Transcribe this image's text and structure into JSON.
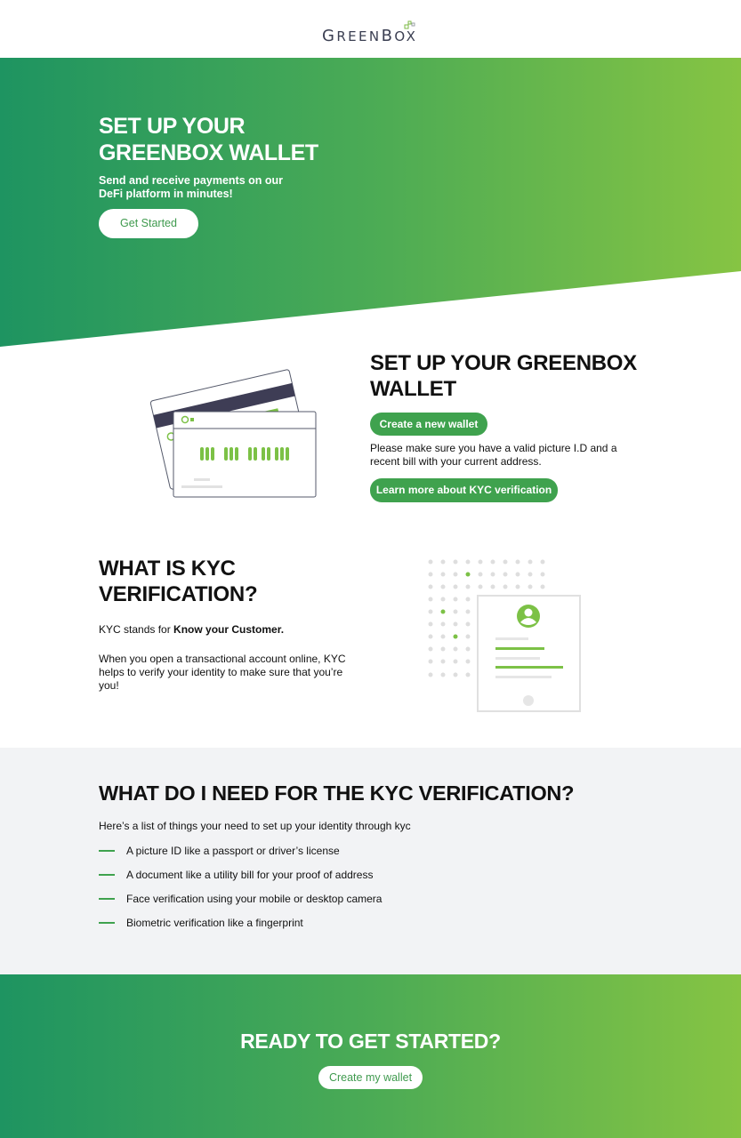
{
  "brand": {
    "logo_g": "G",
    "logo_reen": "REEN",
    "logo_b": "B",
    "logo_o": "O",
    "logo_x": "X",
    "accent": "#3fa24e",
    "gradient_start": "#1e9461",
    "gradient_end": "#86c443"
  },
  "hero": {
    "title": "SET UP YOUR GREENBOX WALLET",
    "subtitle": "Send and receive payments on our DeFi platform in minutes!",
    "button": "Get Started"
  },
  "setup": {
    "title": "SET UP YOUR GREENBOX WALLET",
    "create_button": "Create a new wallet",
    "note": "Please make sure you have a valid picture I.D and a recent bill with your current address.",
    "learn_button": "Learn more about KYC verification"
  },
  "kyc": {
    "title": "WHAT IS KYC VERIFICATION?",
    "stands_prefix": "KYC stands for ",
    "stands_bold": "Know your Customer.",
    "description": "When you open a transactional account online, KYC helps to verify your identity to make sure that you’re you!"
  },
  "requirements": {
    "title": "WHAT DO I NEED FOR THE KYC VERIFICATION?",
    "intro": "Here’s a list of things your need to set up your identity through kyc",
    "items": [
      "A picture ID like a passport or driver’s license",
      "A document like a utility bill for your proof of address",
      "Face verification using your mobile or desktop camera",
      "Biometric verification like a fingerprint"
    ]
  },
  "cta": {
    "title": "READY TO GET STARTED?",
    "button": "Create my wallet"
  }
}
